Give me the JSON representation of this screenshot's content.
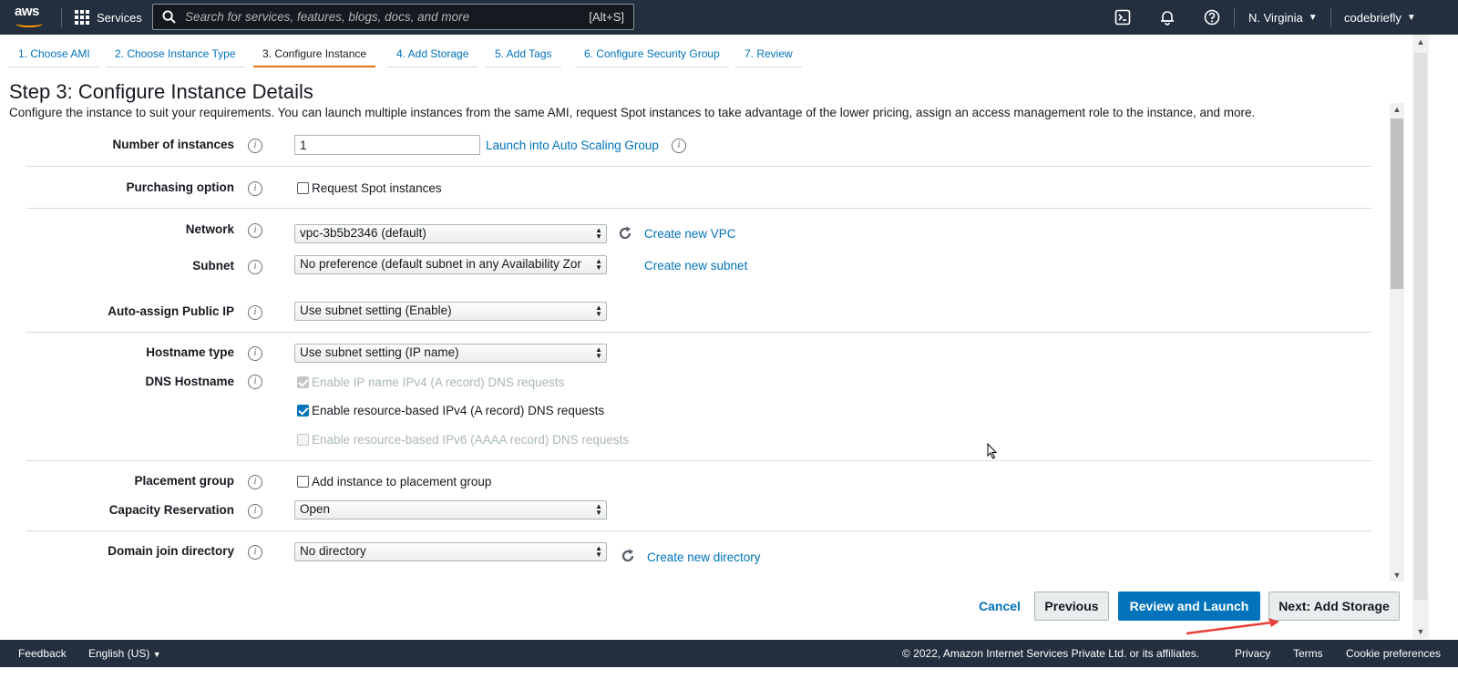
{
  "topnav": {
    "logo_text": "aws",
    "services_label": "Services",
    "search_placeholder": "Search for services, features, blogs, docs, and more",
    "search_shortcut": "[Alt+S]",
    "region": "N. Virginia",
    "account": "codebriefly",
    "colors": {
      "bg": "#232f3e",
      "accent": "#ff9900"
    }
  },
  "wizard": {
    "tabs": [
      {
        "label": "1. Choose AMI",
        "active": false
      },
      {
        "label": "2. Choose Instance Type",
        "active": false
      },
      {
        "label": "3. Configure Instance",
        "active": true
      },
      {
        "label": "4. Add Storage",
        "active": false
      },
      {
        "label": "5. Add Tags",
        "active": false
      },
      {
        "label": "6. Configure Security Group",
        "active": false
      },
      {
        "label": "7. Review",
        "active": false
      }
    ]
  },
  "page": {
    "title": "Step 3: Configure Instance Details",
    "description": "Configure the instance to suit your requirements. You can launch multiple instances from the same AMI, request Spot instances to take advantage of the lower pricing, assign an access management role to the instance, and more."
  },
  "form": {
    "number_of_instances": {
      "label": "Number of instances",
      "value": "1",
      "link": "Launch into Auto Scaling Group"
    },
    "purchasing_option": {
      "label": "Purchasing option",
      "checkbox": "Request Spot instances",
      "checked": false
    },
    "network": {
      "label": "Network",
      "value": "vpc-3b5b2346 (default)",
      "link": "Create new VPC"
    },
    "subnet": {
      "label": "Subnet",
      "value": "No preference (default subnet in any Availability Zor",
      "link": "Create new subnet"
    },
    "auto_assign_ip": {
      "label": "Auto-assign Public IP",
      "value": "Use subnet setting (Enable)"
    },
    "hostname_type": {
      "label": "Hostname type",
      "value": "Use subnet setting (IP name)"
    },
    "dns_hostname": {
      "label": "DNS Hostname",
      "options": [
        {
          "label": "Enable IP name IPv4 (A record) DNS requests",
          "checked": true,
          "disabled": true
        },
        {
          "label": "Enable resource-based IPv4 (A record) DNS requests",
          "checked": true,
          "disabled": false
        },
        {
          "label": "Enable resource-based IPv6 (AAAA record) DNS requests",
          "checked": false,
          "disabled": true
        }
      ]
    },
    "placement_group": {
      "label": "Placement group",
      "checkbox": "Add instance to placement group",
      "checked": false
    },
    "capacity_reservation": {
      "label": "Capacity Reservation",
      "value": "Open"
    },
    "domain_join": {
      "label": "Domain join directory",
      "value": "No directory",
      "link": "Create new directory"
    }
  },
  "actions": {
    "cancel": "Cancel",
    "previous": "Previous",
    "review_launch": "Review and Launch",
    "next": "Next: Add Storage"
  },
  "footer": {
    "feedback": "Feedback",
    "language": "English (US)",
    "copyright": "© 2022, Amazon Internet Services Private Ltd. or its affiliates.",
    "privacy": "Privacy",
    "terms": "Terms",
    "cookies": "Cookie preferences"
  }
}
